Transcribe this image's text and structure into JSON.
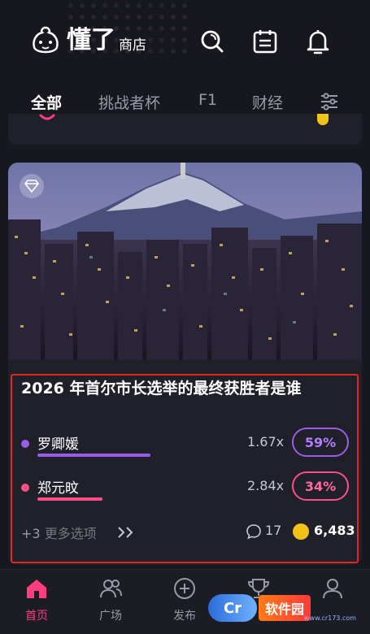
{
  "header": {
    "logo_main": "懂了",
    "logo_sub": "商店",
    "icons": [
      "search-icon",
      "calendar-icon",
      "bell-icon"
    ]
  },
  "tabs": [
    {
      "label": "全部",
      "active": true
    },
    {
      "label": "挑战者杯",
      "active": false
    },
    {
      "label": "F1",
      "active": false
    },
    {
      "label": "财经",
      "active": false
    }
  ],
  "card": {
    "title": "2026 年首尔市长选举的最终获胜者是谁",
    "options": [
      {
        "name": "罗卿媛",
        "odds": "1.67x",
        "percent": "59%",
        "color": "#9b5de5"
      },
      {
        "name": "郑元旼",
        "odds": "2.84x",
        "percent": "34%",
        "color": "#ff4d8a"
      }
    ],
    "more_prefix": "+3",
    "more_label": "更多选项",
    "comment_count": "17",
    "coin_amount": "6,483"
  },
  "bottom_nav": [
    {
      "label": "首页",
      "icon": "home-icon",
      "active": true
    },
    {
      "label": "广场",
      "icon": "people-icon",
      "active": false
    },
    {
      "label": "发布",
      "icon": "plus-circle-icon",
      "active": false
    },
    {
      "label": "",
      "icon": "trophy-icon",
      "active": false
    },
    {
      "label": "",
      "icon": "user-icon",
      "active": false
    }
  ],
  "watermark": {
    "badge": "Cr",
    "text": "软件园",
    "sub": "www.cr173.com"
  },
  "colors": {
    "accent_pink": "#ff3d7f",
    "highlight_red": "#e0261f",
    "purple": "#9b5de5",
    "coin": "#f2c21b"
  }
}
